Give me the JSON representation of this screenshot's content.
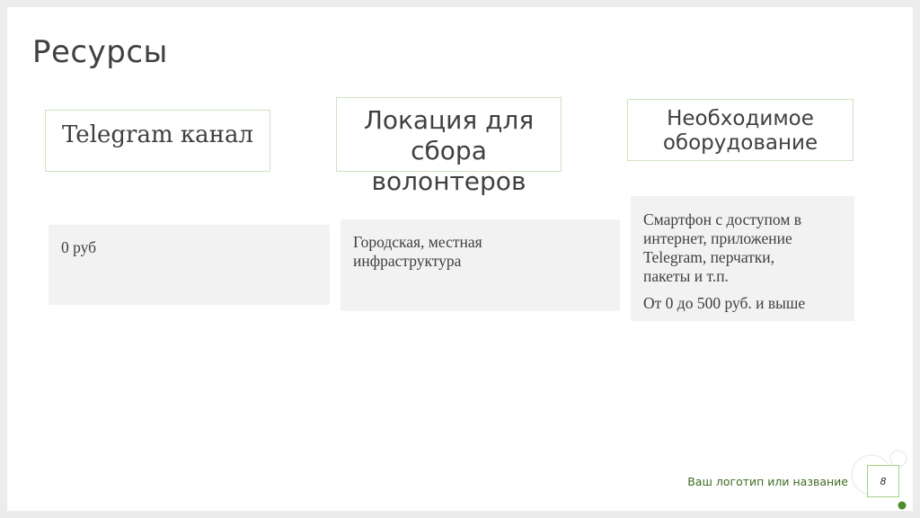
{
  "slide": {
    "title": "Ресурсы",
    "columns": [
      {
        "header": "Telegram канал",
        "body": [
          "0 руб"
        ]
      },
      {
        "header": "Локация для\nсбора\nволонтеров",
        "body": [
          "Городская, местная\nинфраструктура"
        ]
      },
      {
        "header": "Необходимое\nоборудование",
        "body": [
          "Смартфон с доступом в\nинтернет, приложение\nTelegram, перчатки,\nпакеты и т.п.",
          "От 0 до 500 руб. и выше"
        ]
      }
    ],
    "footer": {
      "logo_text": "Ваш логотип или название",
      "page_number": "8"
    }
  },
  "colors": {
    "accent_green": "#a7cf85",
    "dark_green": "#3e6b24",
    "box_border": "#cfe3c4",
    "body_fill": "#f2f2f2"
  }
}
